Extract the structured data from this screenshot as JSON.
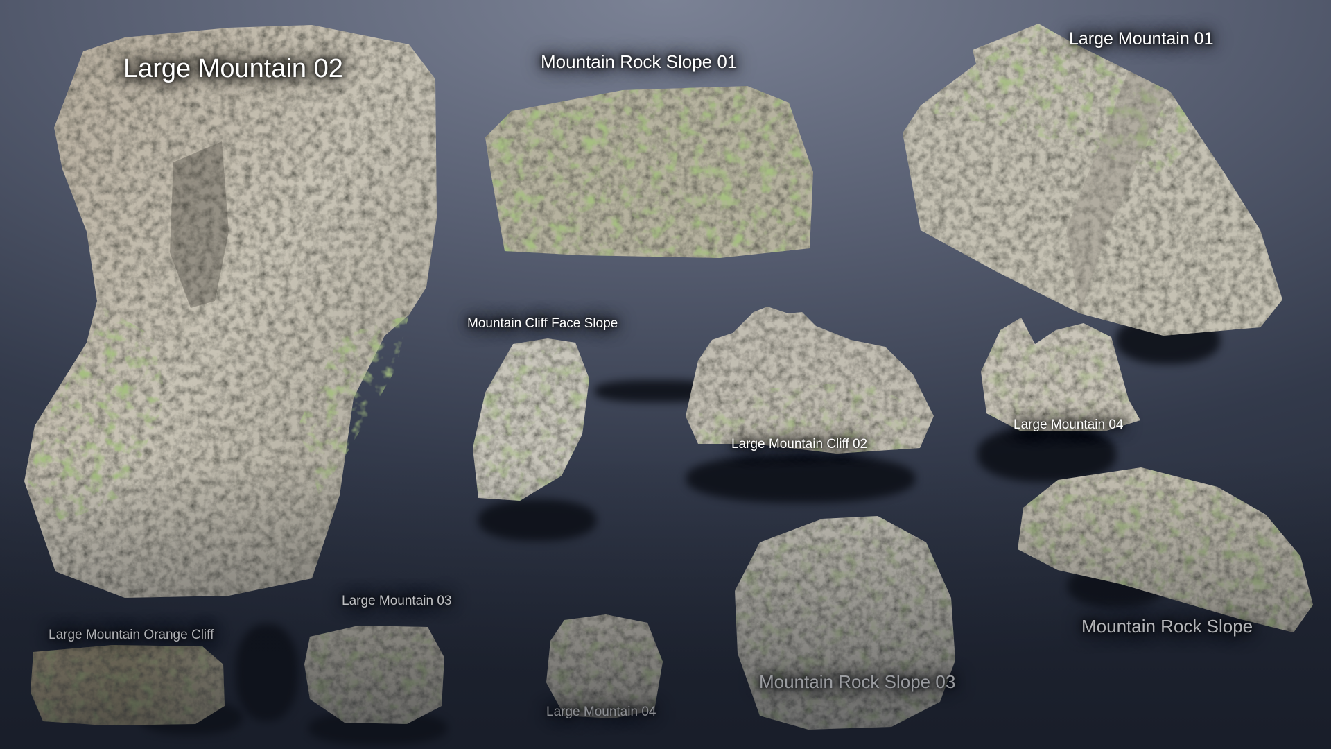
{
  "scene": {
    "background": "#4f566a",
    "rock_color": "#c8c4b8",
    "grass_color": "#6f8a3e",
    "shadow_color": "#0b0e15"
  },
  "assets": {
    "large_mountain_02": {
      "label": "Large Mountain 02"
    },
    "mountain_rock_slope_01": {
      "label": "Mountain Rock Slope 01"
    },
    "large_mountain_01": {
      "label": "Large Mountain 01"
    },
    "mountain_cliff_face_slope": {
      "label": "Mountain Cliff Face Slope"
    },
    "large_mountain_cliff_02": {
      "label": "Large Mountain Cliff  02"
    },
    "large_mountain_04_right": {
      "label": "Large Mountain 04"
    },
    "mountain_rock_slope": {
      "label": "Mountain Rock Slope"
    },
    "mountain_rock_slope_03": {
      "label": "Mountain Rock Slope 03"
    },
    "large_mountain_04_bottom": {
      "label": "Large Mountain 04"
    },
    "large_mountain_03": {
      "label": "Large Mountain 03"
    },
    "large_mountain_orange_cliff": {
      "label": "Large Mountain Orange Cliff"
    }
  }
}
